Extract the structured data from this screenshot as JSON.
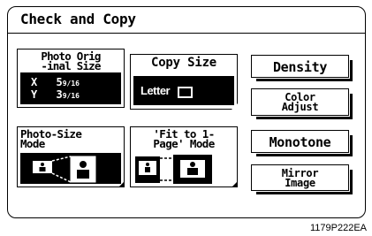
{
  "screen": {
    "title": "Check and Copy",
    "photo_size": {
      "label": "Photo Orig\n-inal Size",
      "x_label": "X",
      "y_label": "Y",
      "x_value": "5 9/16",
      "y_value": "3 9/16",
      "x_whole": "5",
      "x_frac": "9/16",
      "y_whole": "3",
      "y_frac": "9/16"
    },
    "copy_size": {
      "label": "Copy Size",
      "value": "Letter"
    },
    "photo_size_mode": {
      "label": "Photo-Size\nMode"
    },
    "fit_mode": {
      "label": "'Fit to 1-\nPage' Mode"
    },
    "buttons": {
      "density": "Density",
      "color_adjust_line1": "Color",
      "color_adjust_line2": "Adjust",
      "monotone": "Monotone",
      "mirror_line1": "Mirror",
      "mirror_line2": "Image"
    }
  },
  "caption": "1179P222EA"
}
